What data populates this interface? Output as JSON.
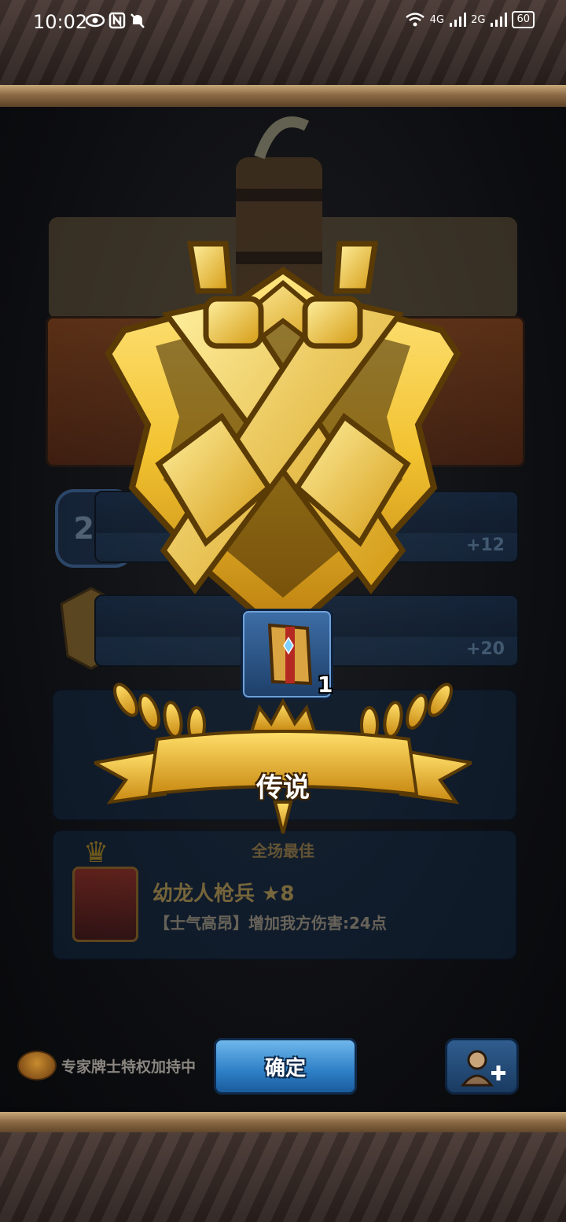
{
  "status_bar": {
    "time": "10:02",
    "signal_4g": "4G",
    "signal_2g": "2G",
    "battery": "60"
  },
  "background": {
    "level_badge": "24",
    "row1_bonus": "+12",
    "row2_bonus": "+20",
    "best_title": "全场最佳",
    "hero_name": "幼龙人枪兵 ★8",
    "hero_desc": "【士气高昂】增加我方伤害:24点"
  },
  "reward": {
    "rank_label": "传说",
    "item_count": "1",
    "item_icon": "tome-icon"
  },
  "footer": {
    "privilege_text": "专家牌士特权加持中",
    "confirm_label": "确定",
    "add_friend_icon": "add-friend-icon"
  },
  "colors": {
    "gold": "#f2c230",
    "confirm_blue": "#2d7fc6",
    "panel_blue": "#132b48"
  }
}
